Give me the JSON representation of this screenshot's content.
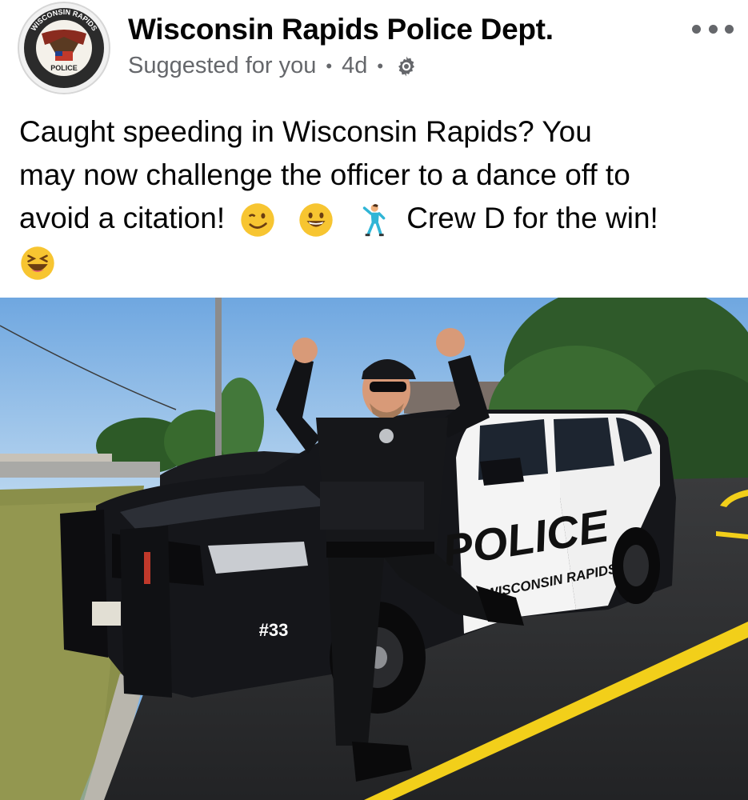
{
  "header": {
    "page_name": "Wisconsin Rapids Police Dept.",
    "suggested": "Suggested for you",
    "separator": "•",
    "time": "4d",
    "privacy_icon": "gear-icon",
    "more_icon": "more-options-icon"
  },
  "logo": {
    "ring_text_top": "WISCONSIN RAPIDS",
    "ring_text_bottom": "POLICE"
  },
  "post": {
    "line1": "Caught speeding in Wisconsin Rapids? You",
    "line2": "may now challenge the officer to a dance off to",
    "line3_start": "avoid a citation!",
    "line3_end": "Crew D for the win!",
    "emojis": [
      "winking-face",
      "grinning-face",
      "dancing-man",
      "laughing-face"
    ]
  },
  "photo": {
    "door_text": "POLICE",
    "door_subtext": "WISCONSIN RAPIDS",
    "unit_number": "#33"
  },
  "colors": {
    "accent_text": "#050505",
    "meta_text": "#65676b",
    "sky": "#7fb3e6",
    "road_line": "#f2cf1a"
  }
}
